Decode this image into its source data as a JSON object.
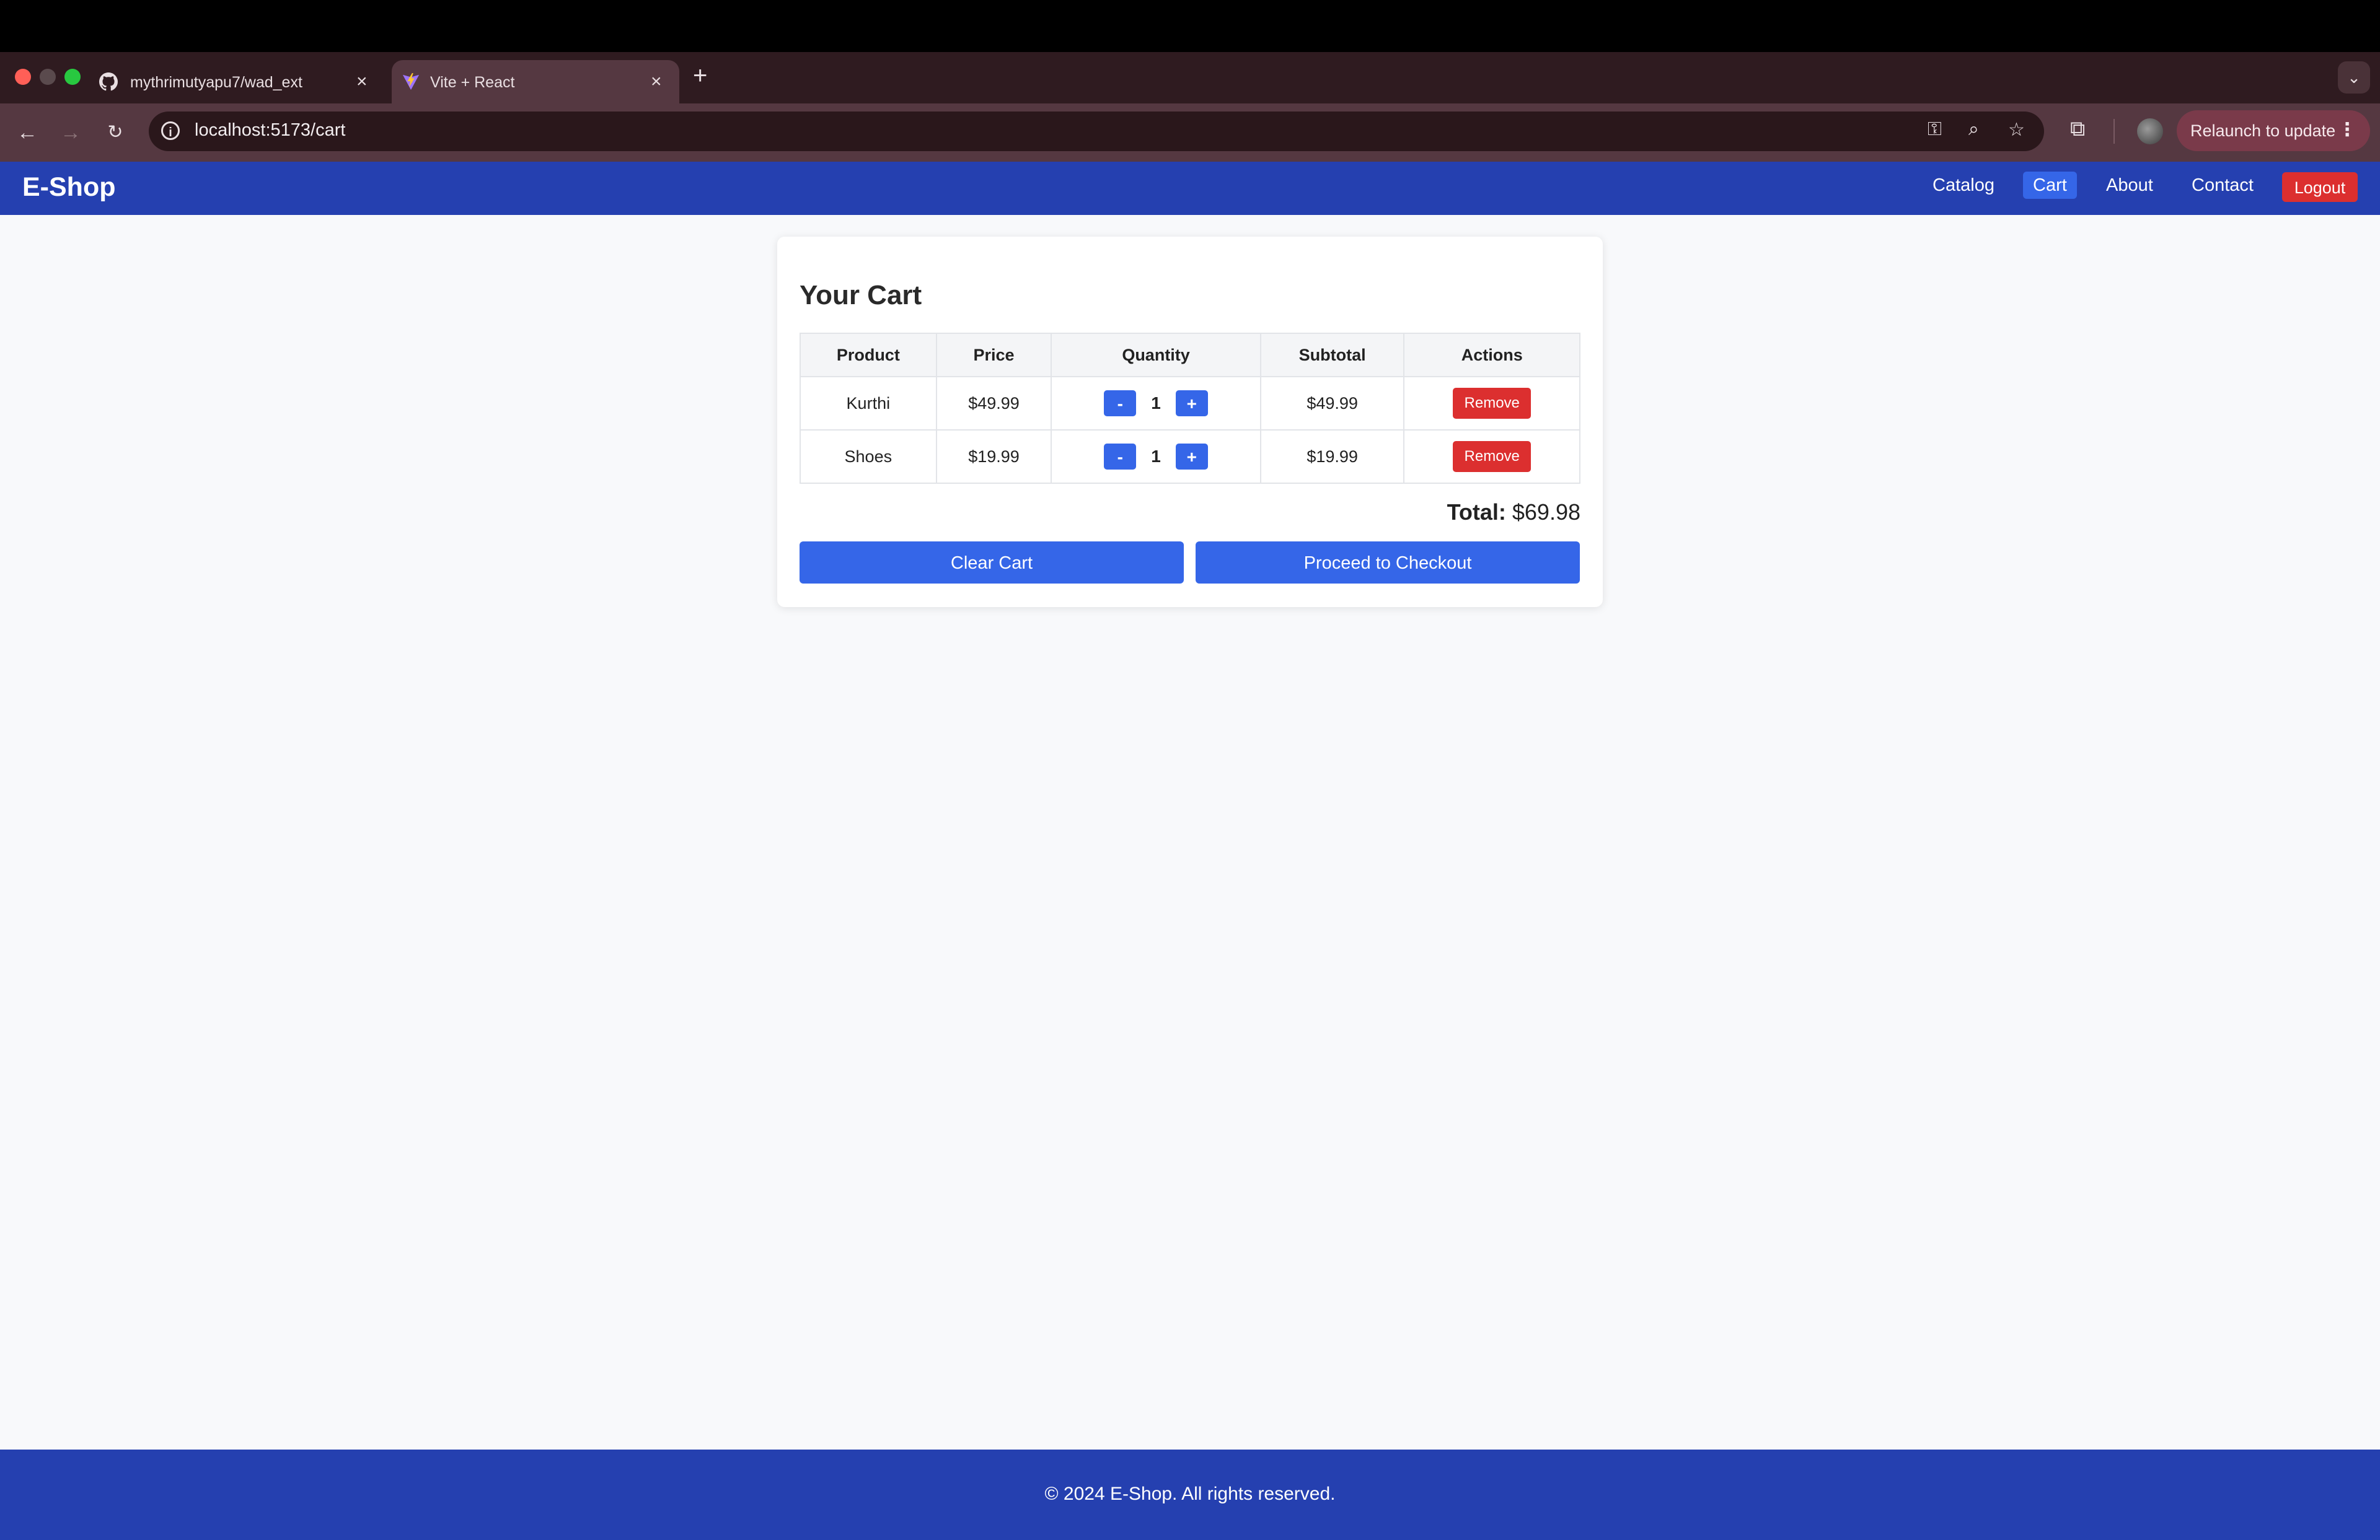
{
  "browser": {
    "tabs": [
      {
        "title": "mythrimutyapu7/wad_ext",
        "icon": "github-icon",
        "active": false
      },
      {
        "title": "Vite + React",
        "icon": "vite-icon",
        "active": true
      }
    ],
    "new_tab_label": "+",
    "url": "localhost:5173/cart",
    "relaunch_label": "Relaunch to update"
  },
  "navbar": {
    "brand": "E-Shop",
    "links": [
      {
        "label": "Catalog",
        "active": false
      },
      {
        "label": "Cart",
        "active": true
      },
      {
        "label": "About",
        "active": false
      },
      {
        "label": "Contact",
        "active": false
      }
    ],
    "logout_label": "Logout"
  },
  "cart": {
    "title": "Your Cart",
    "columns": [
      "Product",
      "Price",
      "Quantity",
      "Subtotal",
      "Actions"
    ],
    "rows": [
      {
        "product": "Kurthi",
        "price": "$49.99",
        "quantity": "1",
        "subtotal": "$49.99",
        "remove_label": "Remove",
        "decrement_label": "-",
        "increment_label": "+"
      },
      {
        "product": "Shoes",
        "price": "$19.99",
        "quantity": "1",
        "subtotal": "$19.99",
        "remove_label": "Remove",
        "decrement_label": "-",
        "increment_label": "+"
      }
    ],
    "total_label": "Total:",
    "total_value": "$69.98",
    "clear_label": "Clear Cart",
    "checkout_label": "Proceed to Checkout"
  },
  "footer": {
    "text": "© 2024 E-Shop. All rights reserved."
  },
  "colors": {
    "navbar": "#2540b0",
    "primary_button": "#3566e8",
    "danger_button": "#dc2f2f",
    "page_background": "#f8f9fb"
  }
}
